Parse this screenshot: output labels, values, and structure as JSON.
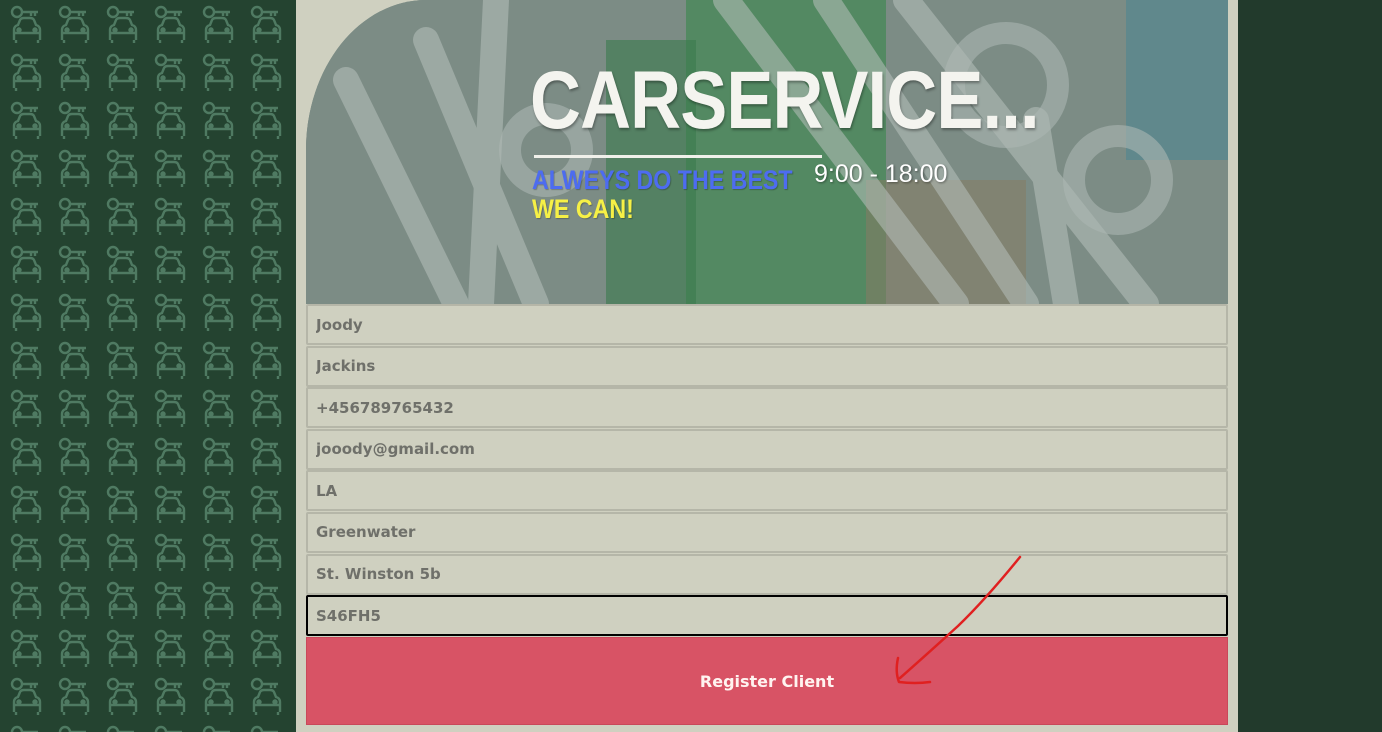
{
  "header": {
    "title": "CARSERVICE...",
    "slogan_line1": "ALWEYS DO THE BEST",
    "slogan_line2": "WE CAN!",
    "hours": "9:00 - 18:00"
  },
  "form": {
    "first_name": "Joody",
    "last_name": "Jackins",
    "phone": "+456789765432",
    "email": "jooody@gmail.com",
    "state": "LA",
    "city": "Greenwater",
    "street": "St. Winston 5b",
    "zip": "S46FH5",
    "submit_label": "Register Client"
  },
  "colors": {
    "page_bg": "#cfd0c0",
    "outer_bg": "#213a2c",
    "button": "#d85365",
    "slogan_blue": "#4d6cf0",
    "slogan_yellow": "#f6f046",
    "annotation_arrow": "#e02020"
  },
  "icons": [
    "car-icon",
    "key-icon",
    "annotation-arrow"
  ]
}
